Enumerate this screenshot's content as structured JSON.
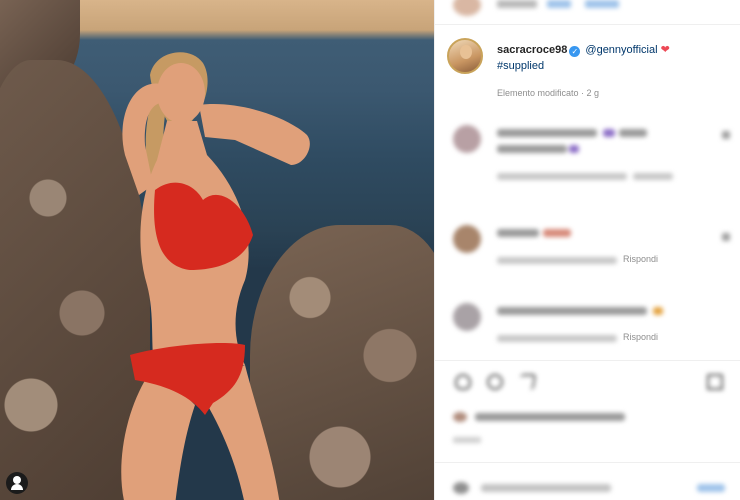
{
  "post": {
    "username": "sacracroce98",
    "mention": "@gennyofficial",
    "heart_symbol": "❤",
    "hashtag": "#supplied",
    "edited_label": "Elemento modificato · 2 g"
  },
  "comments": [
    {
      "reply_label": "Rispondi"
    },
    {
      "reply_label": "Rispondi"
    },
    {
      "reply_label": "Rispondi"
    }
  ],
  "colors": {
    "link": "#00376b",
    "verified": "#3897f0",
    "heart": "#ed4956",
    "meta": "#8e8e8e"
  }
}
